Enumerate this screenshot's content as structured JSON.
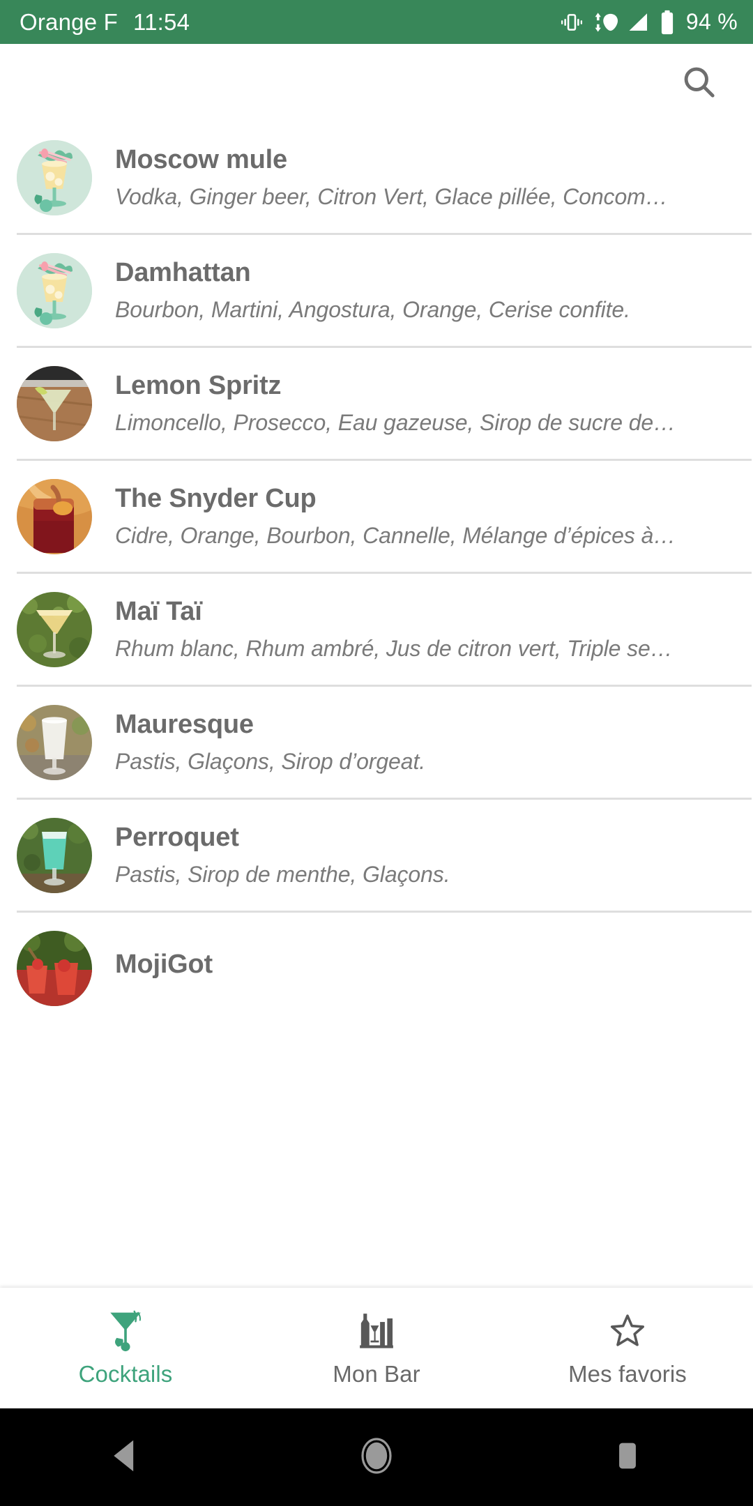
{
  "status_bar": {
    "carrier": "Orange F",
    "clock": "11:54",
    "battery_percent": "94 %",
    "icons": [
      "vibrate-icon",
      "wifi-icon",
      "signal-icon",
      "battery-icon"
    ],
    "background_color": "#388759",
    "foreground_color": "#ffffff"
  },
  "app_bar": {
    "search_icon": "search-icon",
    "icon_color": "#6e6e6e"
  },
  "cocktails": [
    {
      "name": "Moscow mule",
      "ingredients": "Vodka, Ginger beer, Citron Vert, Glace pillée, Concom…",
      "thumb_type": "illustration",
      "thumb_bg": "#cfe6da"
    },
    {
      "name": "Damhattan",
      "ingredients": "Bourbon, Martini, Angostura, Orange, Cerise confite.",
      "thumb_type": "illustration",
      "thumb_bg": "#cfe6da"
    },
    {
      "name": "Lemon Spritz",
      "ingredients": "Limoncello, Prosecco, Eau gazeuse, Sirop de sucre de…",
      "thumb_type": "photo",
      "thumb_bg": "#a9784f"
    },
    {
      "name": "The Snyder Cup",
      "ingredients": "Cidre, Orange, Bourbon, Cannelle, Mélange d’épices à…",
      "thumb_type": "photo",
      "thumb_bg": "#8e1a1f"
    },
    {
      "name": "Maï Taï",
      "ingredients": "Rhum blanc, Rhum ambré, Jus de citron vert, Triple se…",
      "thumb_type": "photo",
      "thumb_bg": "#5d7a33"
    },
    {
      "name": "Mauresque",
      "ingredients": "Pastis, Glaçons, Sirop d’orgeat.",
      "thumb_type": "photo",
      "thumb_bg": "#9c8f66"
    },
    {
      "name": "Perroquet",
      "ingredients": "Pastis, Sirop de menthe, Glaçons.",
      "thumb_type": "photo",
      "thumb_bg": "#4f7033"
    },
    {
      "name": "MojiGot",
      "ingredients": "",
      "thumb_type": "photo",
      "thumb_bg": "#b5342c"
    }
  ],
  "bottom_nav": {
    "active_color": "#3ea37c",
    "inactive_color": "#696969",
    "tabs": [
      {
        "label": "Cocktails",
        "icon": "cocktail-glass-icon",
        "active": true
      },
      {
        "label": "Mon Bar",
        "icon": "bottles-icon",
        "active": false
      },
      {
        "label": "Mes favoris",
        "icon": "star-icon",
        "active": false
      }
    ]
  },
  "system_nav": {
    "buttons": [
      {
        "icon": "back-icon"
      },
      {
        "icon": "home-icon"
      },
      {
        "icon": "recents-icon"
      }
    ],
    "color": "#9a9a9a",
    "background": "#000000"
  }
}
